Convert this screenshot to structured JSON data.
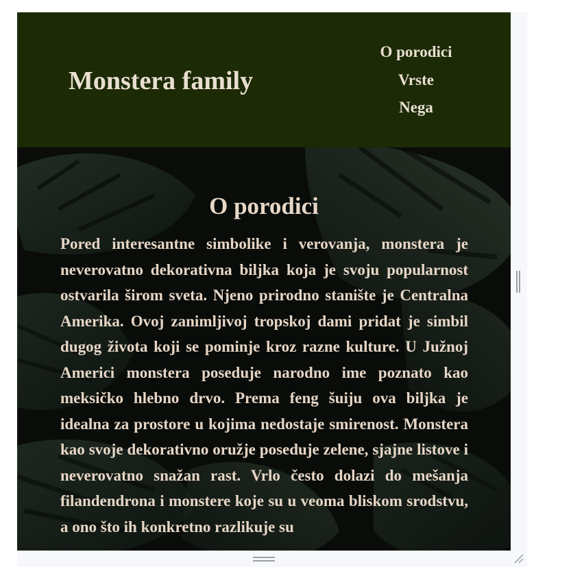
{
  "header": {
    "brand": "Monstera family",
    "nav": [
      {
        "label": "O porodici"
      },
      {
        "label": "Vrste"
      },
      {
        "label": "Nega"
      }
    ]
  },
  "section": {
    "title": "O porodici",
    "text": "Pored interesantne simbolike i verovanja, monstera je neverovatno dekorativna biljka koja je svoju popularnost ostvarila širom sveta. Njeno prirodno stanište je Centralna Amerika. Ovoj zanimljivoj tropskoj dami pridat je simbil dugog života koji se pominje kroz razne kulture. U Južnoj Americi monstera poseduje narodno ime poznato kao meksičko hlebno drvo. Prema feng šuiju ova biljka je idealna za prostore u kojima nedostaje smirenost. Monstera kao svoje dekorativno oružje poseduje zelene, sjajne listove i neverovatno snažan rast. Vrlo često dolazi do mešanja filandendrona i monstere koje su u veoma bliskom srodstvu, a ono što ih konkretno razlikuje su"
  },
  "colors": {
    "header_bg": "#1c2a05",
    "text": "#e6d6c6",
    "frame": "#f7f8fb"
  }
}
